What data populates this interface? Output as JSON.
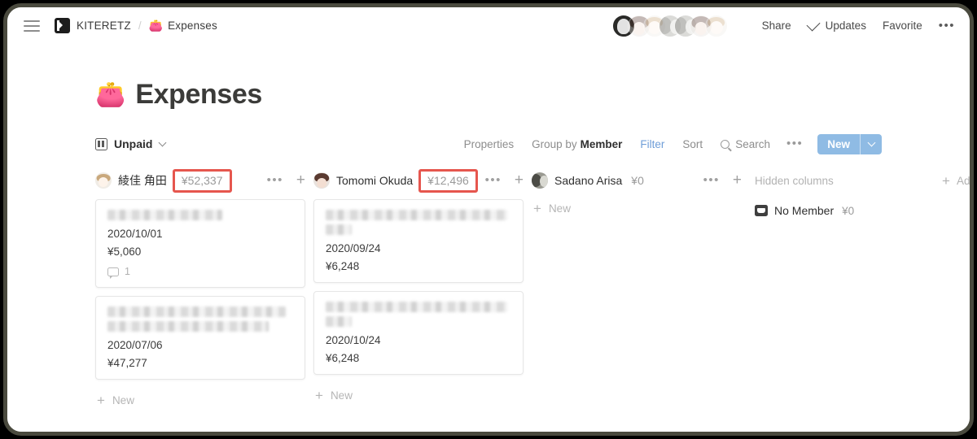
{
  "topbar": {
    "menu_icon": "hamburger-icon",
    "workspace": "KITERETZ",
    "separator": "/",
    "breadcrumb_emoji": "👛",
    "breadcrumb_page": "Expenses",
    "share_label": "Share",
    "updates_label": "Updates",
    "favorite_label": "Favorite",
    "more_label": "•••",
    "avatar_count": 7
  },
  "page": {
    "emoji": "👛",
    "title": "Expenses"
  },
  "toolbar": {
    "view_icon": "board-view-icon",
    "view_name": "Unpaid",
    "properties_label": "Properties",
    "group_by_label": "Group by",
    "group_by_value": "Member",
    "filter_label": "Filter",
    "sort_label": "Sort",
    "search_label": "Search",
    "more_label": "•••",
    "new_label": "New",
    "filter_color": "#6f9ed8",
    "new_button_color": "#8fbbe4"
  },
  "board": {
    "annotation_color": "#e6564e",
    "columns": [
      {
        "name": "綾佳 角田",
        "sum": "¥52,337",
        "sum_highlighted": true,
        "add_label": "New",
        "cards": [
          {
            "title_lines": 1,
            "date": "2020/10/01",
            "amount": "¥5,060",
            "comment_count": "1"
          },
          {
            "title_lines": 2,
            "date": "2020/07/06",
            "amount": "¥47,277",
            "comment_count": null
          }
        ]
      },
      {
        "name": "Tomomi Okuda",
        "sum": "¥12,496",
        "sum_highlighted": true,
        "add_label": "New",
        "cards": [
          {
            "title_lines": 2,
            "date": "2020/09/24",
            "amount": "¥6,248",
            "comment_count": null
          },
          {
            "title_lines": 2,
            "date": "2020/10/24",
            "amount": "¥6,248",
            "comment_count": null
          }
        ]
      },
      {
        "name": "Sadano Arisa",
        "sum": "¥0",
        "sum_highlighted": false,
        "add_label": "New",
        "cards": []
      }
    ],
    "hidden": {
      "heading": "Hidden columns",
      "items": [
        {
          "name": "No Member",
          "sum": "¥0"
        }
      ]
    },
    "add_group_label": "Add"
  }
}
